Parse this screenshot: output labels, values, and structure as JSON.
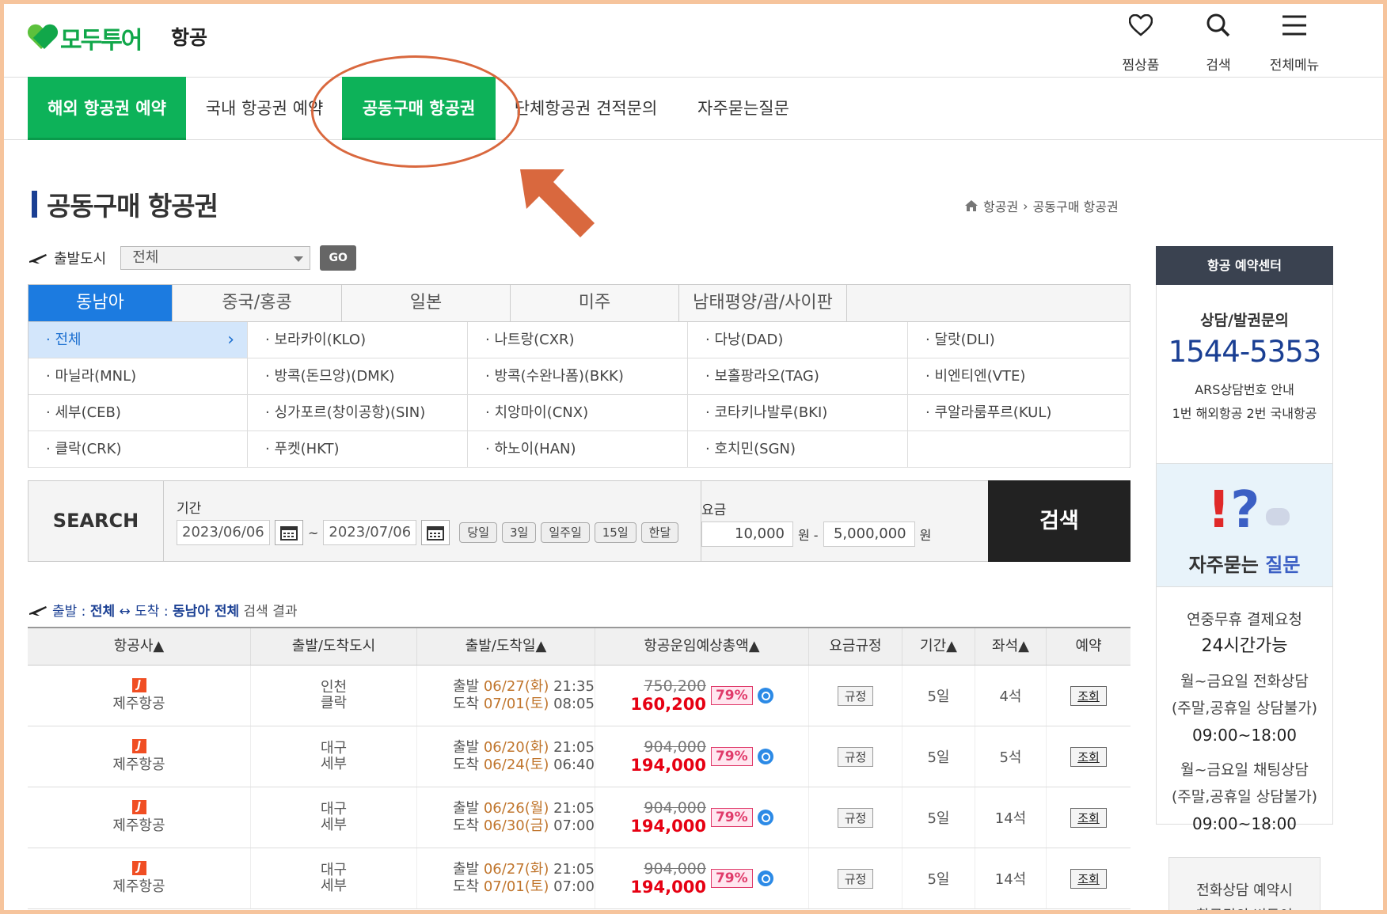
{
  "header": {
    "logo_text": "모두투어",
    "section_name": "항공",
    "util": [
      {
        "label": "찜상품",
        "icon": "heart-icon"
      },
      {
        "label": "검색",
        "icon": "search-icon"
      },
      {
        "label": "전체메뉴",
        "icon": "menu-icon"
      }
    ]
  },
  "gnb": {
    "items": [
      {
        "label": "해외 항공권 예약",
        "active": true
      },
      {
        "label": "국내 항공권 예약",
        "active": false
      },
      {
        "label": "공동구매 항공권",
        "active": true
      },
      {
        "label": "단체항공권 견적문의",
        "active": false
      },
      {
        "label": "자주묻는질문",
        "active": false
      }
    ]
  },
  "page": {
    "title": "공동구매 항공권",
    "breadcrumb": [
      "항공권",
      "공동구매 항공권"
    ]
  },
  "depart": {
    "label": "출발도시",
    "selected": "전체",
    "go_label": "GO"
  },
  "regions": {
    "tabs": [
      "동남아",
      "중국/홍콩",
      "일본",
      "미주",
      "남태평양/괌/사이판"
    ],
    "cities": [
      "전체",
      "보라카이(KLO)",
      "나트랑(CXR)",
      "다낭(DAD)",
      "달랏(DLI)",
      "마닐라(MNL)",
      "방콕(돈므앙)(DMK)",
      "방콕(수완나폼)(BKK)",
      "보홀팡라오(TAG)",
      "비엔티엔(VTE)",
      "세부(CEB)",
      "싱가포르(창이공항)(SIN)",
      "치앙마이(CNX)",
      "코타키나발루(BKI)",
      "쿠알라룸푸르(KUL)",
      "클락(CRK)",
      "푸켓(HKT)",
      "하노이(HAN)",
      "호치민(SGN)",
      ""
    ]
  },
  "search": {
    "label": "SEARCH",
    "period_label": "기간",
    "date_from": "2023/06/06",
    "date_to": "2023/07/06",
    "tilde": "~",
    "chips": [
      "당일",
      "3일",
      "일주일",
      "15일",
      "한달"
    ],
    "fare_label": "요금",
    "fare_min": "10,000",
    "fare_max": "5,000,000",
    "won": "원",
    "won_dash": "원 -",
    "button": "검색"
  },
  "summary": {
    "dep_label": "출발 : ",
    "dep": "전체",
    "arrow": "↔",
    "arr_label": "도착 : ",
    "arr": "동남아 전체",
    "suffix": "검색 결과"
  },
  "table": {
    "headers": [
      "항공사▲",
      "출발/도착도시",
      "출발/도착일▲",
      "항공운임예상총액▲",
      "요금규정",
      "기간▲",
      "좌석▲",
      "예약"
    ],
    "rows": [
      {
        "airline": "제주항공",
        "from": "인천",
        "to": "클락",
        "dep_label": "출발",
        "dep_date": "06/27(화)",
        "dep_time": "21:35",
        "arr_label": "도착",
        "arr_date": "07/01(토)",
        "arr_time": "08:05",
        "old": "750,200",
        "new": "160,200",
        "pct": "79%",
        "rule": "규정",
        "period": "5일",
        "seats": "4석",
        "view": "조회"
      },
      {
        "airline": "제주항공",
        "from": "대구",
        "to": "세부",
        "dep_label": "출발",
        "dep_date": "06/20(화)",
        "dep_time": "21:05",
        "arr_label": "도착",
        "arr_date": "06/24(토)",
        "arr_time": "06:40",
        "old": "904,000",
        "new": "194,000",
        "pct": "79%",
        "rule": "규정",
        "period": "5일",
        "seats": "5석",
        "view": "조회"
      },
      {
        "airline": "제주항공",
        "from": "대구",
        "to": "세부",
        "dep_label": "출발",
        "dep_date": "06/26(월)",
        "dep_time": "21:05",
        "arr_label": "도착",
        "arr_date": "06/30(금)",
        "arr_time": "07:00",
        "old": "904,000",
        "new": "194,000",
        "pct": "79%",
        "rule": "규정",
        "period": "5일",
        "seats": "14석",
        "view": "조회"
      },
      {
        "airline": "제주항공",
        "from": "대구",
        "to": "세부",
        "dep_label": "출발",
        "dep_date": "06/27(화)",
        "dep_time": "21:05",
        "arr_label": "도착",
        "arr_date": "07/01(토)",
        "arr_time": "07:00",
        "old": "904,000",
        "new": "194,000",
        "pct": "79%",
        "rule": "규정",
        "period": "5일",
        "seats": "14석",
        "view": "조회"
      }
    ]
  },
  "sidebar": {
    "head": "항공 예약센터",
    "consult": "상담/발권문의",
    "tel": "1544-5353",
    "ars": "ARS상담번호 안내",
    "ars_detail": "1번 해외항공 2번 국내항공",
    "faq_label_a": "자주묻는 ",
    "faq_label_b": "질문",
    "info": {
      "l1": "연중무휴 결제요청",
      "l2": "24시간가능",
      "l3": "월~금요일 전화상담",
      "l4": "(주말,공휴일 상담불가)",
      "l5": "09:00~18:00",
      "l6": "월~금요일 채팅상담",
      "l7": "(주말,공휴일 상담불가)",
      "l8": "09:00~18:00"
    },
    "reserve_1": "전화상담 예약시",
    "reserve_2": "항공권의 변동이"
  },
  "colors": {
    "brand_green": "#0db259",
    "nav_blue": "#1a3f93",
    "tab_blue": "#1c7be0",
    "annotation": "#d9683e",
    "price_red": "#e60012"
  }
}
